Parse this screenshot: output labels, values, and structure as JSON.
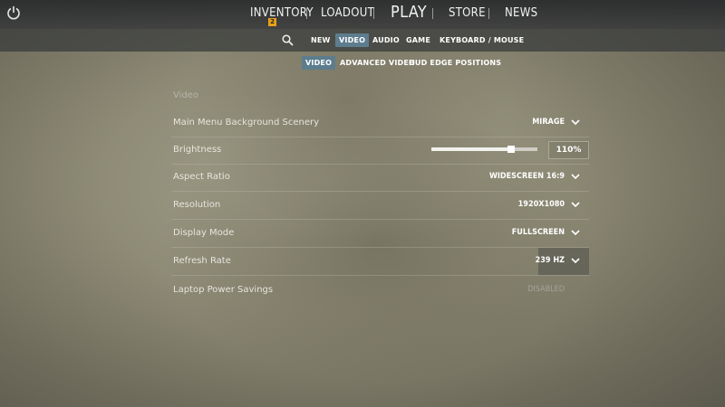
{
  "topnav": {
    "items": [
      {
        "label": "INVENTORY",
        "badge": "2"
      },
      {
        "label": "LOADOUT"
      },
      {
        "label": "PLAY"
      },
      {
        "label": "STORE"
      },
      {
        "label": "NEWS"
      }
    ]
  },
  "subnav": {
    "tabs": [
      {
        "label": "NEW"
      },
      {
        "label": "VIDEO",
        "active": true
      },
      {
        "label": "AUDIO"
      },
      {
        "label": "GAME"
      },
      {
        "label": "KEYBOARD / MOUSE"
      }
    ],
    "subtabs": [
      {
        "label": "VIDEO",
        "active": true
      },
      {
        "label": "ADVANCED VIDEO"
      },
      {
        "label": "HUD EDGE POSITIONS"
      }
    ]
  },
  "settings": {
    "section_title": "Video",
    "rows": [
      {
        "label": "Main Menu Background Scenery",
        "value": "MIRAGE"
      },
      {
        "label": "Brightness",
        "value": "110%",
        "slider_fraction": 0.75
      },
      {
        "label": "Aspect Ratio",
        "value": "WIDESCREEN 16:9"
      },
      {
        "label": "Resolution",
        "value": "1920X1080"
      },
      {
        "label": "Display Mode",
        "value": "FULLSCREEN"
      },
      {
        "label": "Refresh Rate",
        "value": "239 HZ"
      },
      {
        "label": "Laptop Power Savings",
        "value": "DISABLED"
      }
    ]
  },
  "colors": {
    "active_tab": "#5d7d8e",
    "badge": "#e8a019"
  }
}
